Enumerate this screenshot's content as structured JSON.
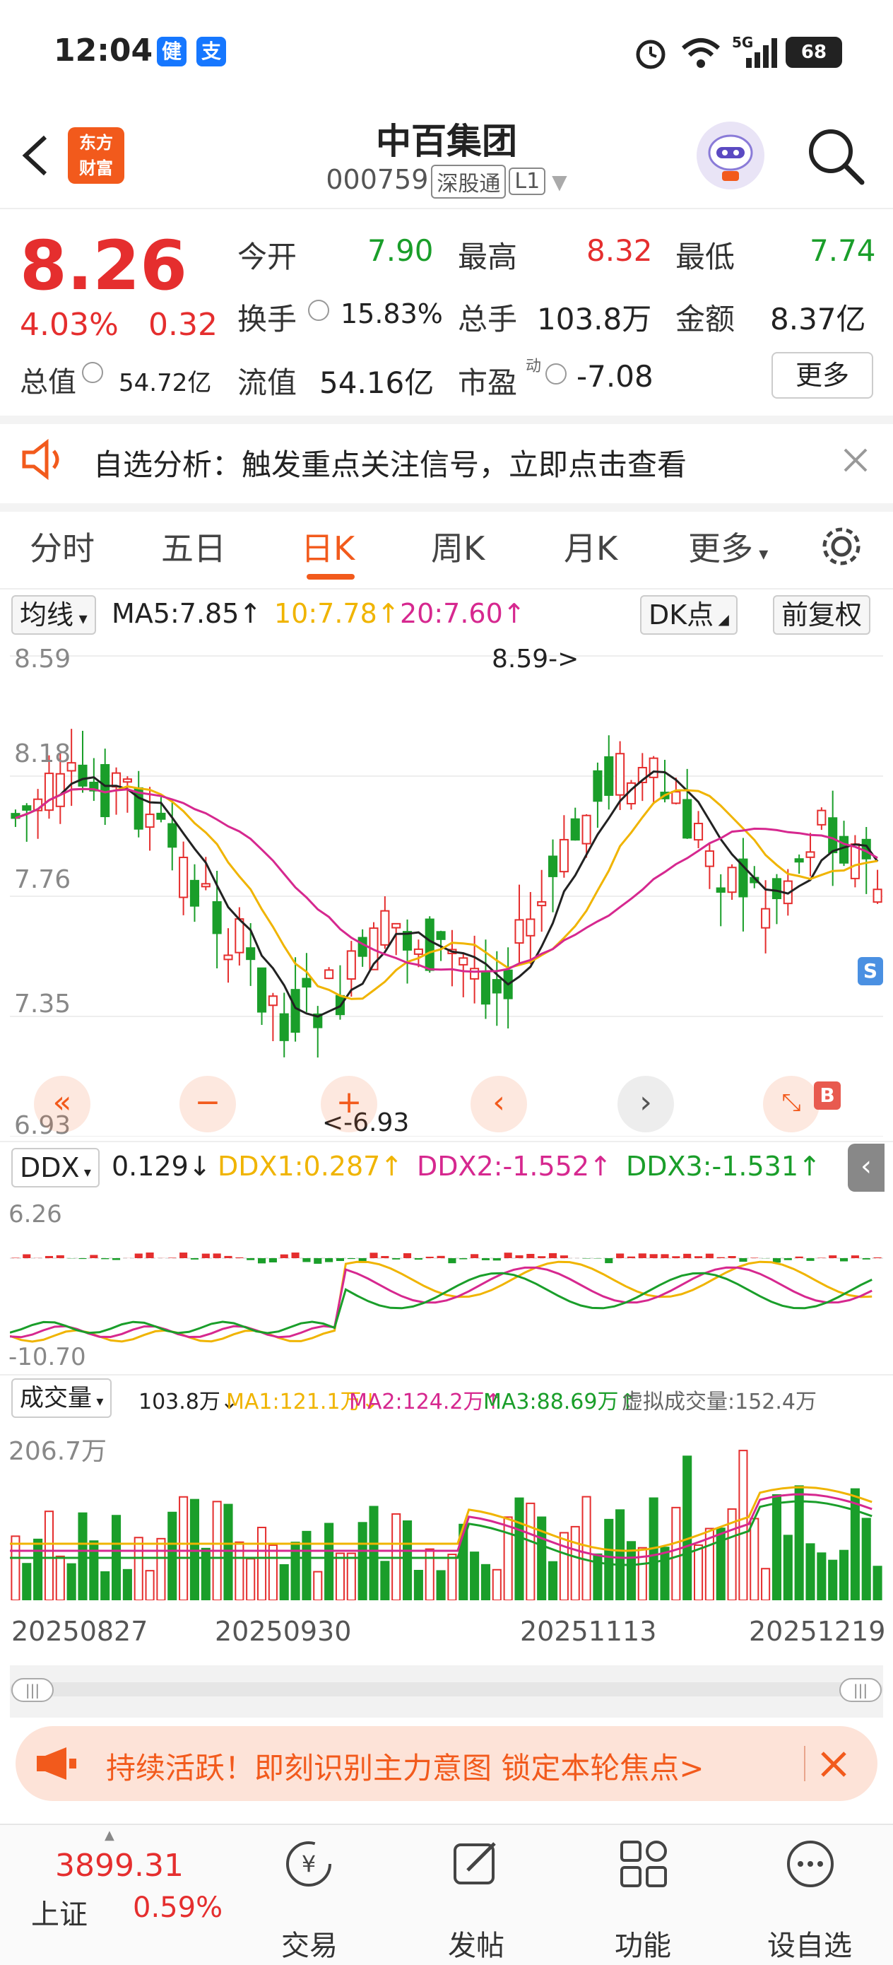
{
  "status_bar": {
    "time": "12:04",
    "app_icon_1": "健",
    "app_icon_2": "支",
    "network": "5G",
    "battery": "68"
  },
  "header": {
    "title": "中百集团",
    "code": "000759",
    "tag1": "深股通",
    "tag2": "L1",
    "logo_line1": "东方",
    "logo_line2": "财富"
  },
  "quote": {
    "price": "8.26",
    "change_pct": "4.03%",
    "change_amt": "0.32",
    "open_label": "今开",
    "open": "7.90",
    "high_label": "最高",
    "high": "8.32",
    "low_label": "最低",
    "low": "7.74",
    "turnover_label": "换手",
    "turnover": "15.83%",
    "volume_label": "总手",
    "volume": "103.8万",
    "amount_label": "金额",
    "amount": "8.37亿",
    "mktcap_label": "总值",
    "mktcap": "54.72亿",
    "float_label": "流值",
    "float": "54.16亿",
    "pe_label": "市盈",
    "pe_sup": "动",
    "pe": "-7.08",
    "more_label": "更多"
  },
  "notice": {
    "text": "自选分析：触发重点关注信号，立即点击查看"
  },
  "tabs": [
    "分时",
    "五日",
    "日K",
    "周K",
    "月K",
    "更多"
  ],
  "active_tab": 2,
  "ma_row": {
    "selector": "均线",
    "ma5": "MA5:7.85↑",
    "ma10": "10:7.78↑",
    "ma20": "20:7.60↑",
    "dk": "DK点",
    "fq": "前复权"
  },
  "kline": {
    "y_labels": [
      "8.59",
      "8.18",
      "7.76",
      "7.35",
      "6.93"
    ],
    "high_note": "8.59->",
    "low_note": "<-6.93",
    "sell_mark": "S",
    "buy_mark": "B"
  },
  "ddx_row": {
    "selector": "DDX",
    "ddx": "0.129↓",
    "ddx1": "DDX1:0.287↑",
    "ddx2": "DDX2:-1.552↑",
    "ddx3": "DDX3:-1.531↑",
    "y_top": "6.26",
    "y_bottom": "-10.70"
  },
  "vol_row": {
    "selector": "成交量",
    "vol": "103.8万↓",
    "ma1": "MA1:121.1万↓",
    "ma2": "MA2:124.2万↑",
    "ma3": "MA3:88.69万↑",
    "virtual": "虚拟成交量:152.4万",
    "y_top": "206.7万"
  },
  "dates": [
    "20250827",
    "20250930",
    "20251113",
    "20251219"
  ],
  "banner": {
    "text": "持续活跃！即刻识别主力意图 锁定本轮焦点>"
  },
  "bottom_nav": {
    "index_value": "3899.31",
    "index_name": "上证",
    "index_change": "0.59%",
    "items": [
      "交易",
      "发帖",
      "功能",
      "设自选"
    ]
  },
  "colors": {
    "up": "#e52e2e",
    "down": "#1a9e2a",
    "accent": "#f25a1c",
    "ma5": "#222222",
    "ma10": "#f0b400",
    "ma20": "#d6288f"
  }
}
